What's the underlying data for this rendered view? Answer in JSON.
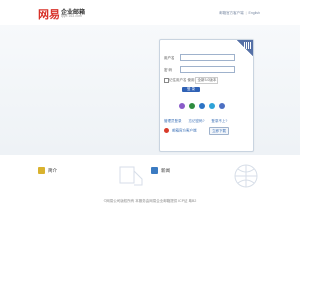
{
  "header": {
    "logo_text": "企业邮箱",
    "logo_sub": "qiye.163.com",
    "links": [
      "邮箱官方客户端",
      "English"
    ]
  },
  "login": {
    "username_label": "用户名",
    "password_label": "密 码",
    "remember_label": "记住用户名",
    "use_label": "使用",
    "version_label": "全新3.0版本",
    "submit_label": "登 录",
    "app_icons": [
      "weixin-icon",
      "qq-icon",
      "weibo-icon",
      "yixin-icon",
      "mail-icon"
    ],
    "app_colors": [
      "#8a5cc9",
      "#2e8c3f",
      "#2c73c5",
      "#2fa3d8",
      "#4d6fc2"
    ],
    "help_links": [
      "管理员登录",
      "忘记密码?",
      "登录不上?"
    ],
    "promo_text": "邮箱官方客户端",
    "download_label": "立即下载"
  },
  "features": [
    {
      "label": "简介",
      "icon": "intro-icon",
      "color": "#d9b22e"
    },
    {
      "label": "新闻",
      "icon": "news-icon",
      "color": "#3b7bc2"
    }
  ],
  "footer": {
    "line": "©网易公司版权所有  本服务由网易企业邮箱提供 ICP证 粤B2"
  },
  "colors": {
    "accent": "#2f61b5",
    "panel_border": "#c9d4e0",
    "corner": "#5570a6"
  }
}
